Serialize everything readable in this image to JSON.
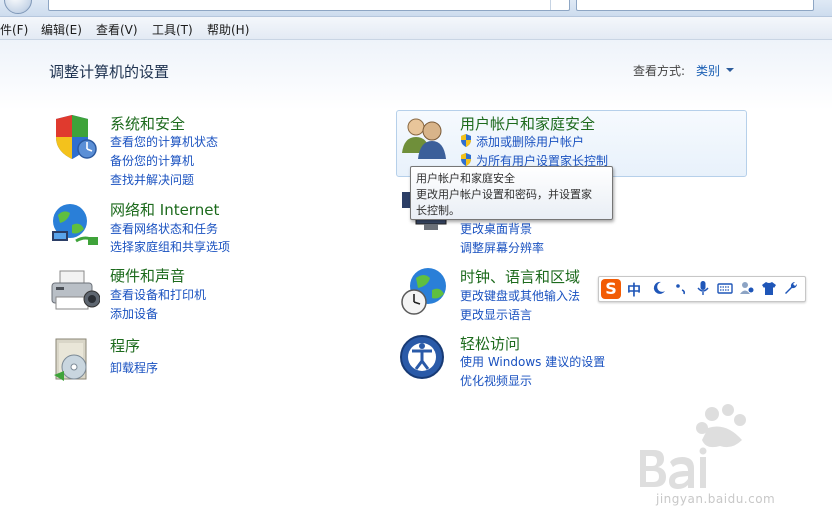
{
  "menu": {
    "file": "件(F)",
    "edit": "编辑(E)",
    "view": "查看(V)",
    "tools": "工具(T)",
    "help": "帮助(H)"
  },
  "page": {
    "title": "调整计算机的设置",
    "view_by_label": "查看方式:",
    "view_by_value": "类别"
  },
  "categories": {
    "system": {
      "title": "系统和安全",
      "links": [
        "查看您的计算机状态",
        "备份您的计算机",
        "查找并解决问题"
      ]
    },
    "network": {
      "title": "网络和 Internet",
      "links": [
        "查看网络状态和任务",
        "选择家庭组和共享选项"
      ]
    },
    "hardware": {
      "title": "硬件和声音",
      "links": [
        "查看设备和打印机",
        "添加设备"
      ]
    },
    "programs": {
      "title": "程序",
      "links": [
        "卸载程序"
      ]
    },
    "users": {
      "title": "用户帐户和家庭安全",
      "links": [
        "添加或删除用户帐户",
        "为所有用户设置家长控制"
      ]
    },
    "appearance": {
      "links": [
        "更改桌面背景",
        "调整屏幕分辨率"
      ]
    },
    "clock": {
      "title": "时钟、语言和区域",
      "links": [
        "更改键盘或其他输入法",
        "更改显示语言"
      ]
    },
    "ease": {
      "title": "轻松访问",
      "links": [
        "使用 Windows 建议的设置",
        "优化视频显示"
      ]
    }
  },
  "tooltip": {
    "line1": "用户帐户和家庭安全",
    "line2": "更改用户帐户设置和密码，并设置家",
    "line3": "长控制。"
  },
  "ime": {
    "mode": "中"
  },
  "watermark": {
    "url": "jingyan.baidu.com"
  },
  "colors": {
    "category_title": "#1c6a1c",
    "link": "#1a52c0",
    "page_title": "#1e3250"
  }
}
